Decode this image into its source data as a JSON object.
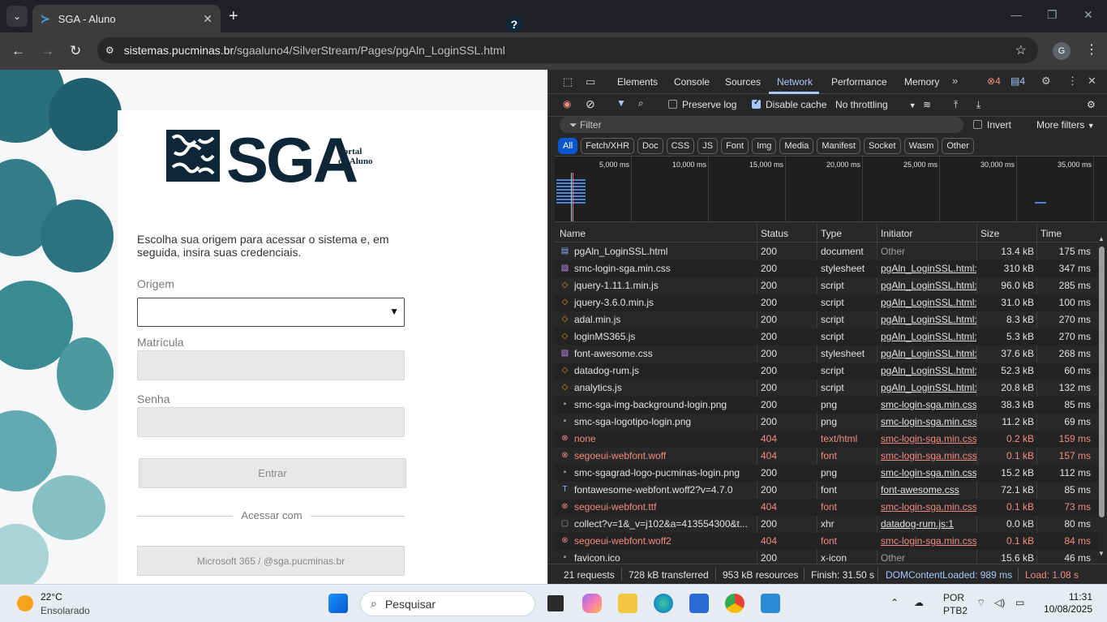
{
  "browser": {
    "tab_title": "SGA - Aluno",
    "url_host": "sistemas.pucminas.br",
    "url_path": "/sgaaluno4/SilverStream/Pages/pgAln_LoginSSL.html",
    "profile_initial": "G"
  },
  "login": {
    "logo_text": "SGA",
    "logo_subtitle_1": "Portal",
    "logo_subtitle_2": "do Aluno",
    "intro": "Escolha sua origem para acessar o sistema e,  em seguida, insira suas credenciais.",
    "origem_label": "Origem",
    "matricula_label": "Matrícula",
    "senha_label": "Senha",
    "entrar_label": "Entrar",
    "acessar_com": "Acessar com",
    "ms365_label": "Microsoft 365 / @sga.pucminas.br",
    "help_glyph": "?"
  },
  "devtools": {
    "tabs": [
      "Elements",
      "Console",
      "Sources",
      "Network",
      "Performance",
      "Memory"
    ],
    "errors_count": "4",
    "messages_count": "4",
    "toolbar": {
      "preserve_log": "Preserve log",
      "disable_cache": "Disable cache",
      "throttling": "No throttling"
    },
    "filter_placeholder": "Filter",
    "invert": "Invert",
    "more_filters": "More filters",
    "chips": [
      "All",
      "Fetch/XHR",
      "Doc",
      "CSS",
      "JS",
      "Font",
      "Img",
      "Media",
      "Manifest",
      "Socket",
      "Wasm",
      "Other"
    ],
    "timeline_labels": [
      "5,000 ms",
      "10,000 ms",
      "15,000 ms",
      "20,000 ms",
      "25,000 ms",
      "30,000 ms",
      "35,000 ms"
    ],
    "columns": [
      "Name",
      "Status",
      "Type",
      "Initiator",
      "Size",
      "Time"
    ],
    "rows": [
      {
        "icon": "doc",
        "name": "pgAln_LoginSSL.html",
        "status": "200",
        "type": "document",
        "initiator": "Other",
        "size": "13.4 kB",
        "time": "175 ms",
        "err": false
      },
      {
        "icon": "css",
        "name": "smc-login-sga.min.css",
        "status": "200",
        "type": "stylesheet",
        "initiator": "pgAln_LoginSSL.html:4",
        "size": "310 kB",
        "time": "347 ms",
        "err": false
      },
      {
        "icon": "js",
        "name": "jquery-1.11.1.min.js",
        "status": "200",
        "type": "script",
        "initiator": "pgAln_LoginSSL.html:4",
        "size": "96.0 kB",
        "time": "285 ms",
        "err": false
      },
      {
        "icon": "js",
        "name": "jquery-3.6.0.min.js",
        "status": "200",
        "type": "script",
        "initiator": "pgAln_LoginSSL.html:4",
        "size": "31.0 kB",
        "time": "100 ms",
        "err": false
      },
      {
        "icon": "js",
        "name": "adal.min.js",
        "status": "200",
        "type": "script",
        "initiator": "pgAln_LoginSSL.html:4",
        "size": "8.3 kB",
        "time": "270 ms",
        "err": false
      },
      {
        "icon": "js",
        "name": "loginMS365.js",
        "status": "200",
        "type": "script",
        "initiator": "pgAln_LoginSSL.html:4",
        "size": "5.3 kB",
        "time": "270 ms",
        "err": false
      },
      {
        "icon": "css",
        "name": "font-awesome.css",
        "status": "200",
        "type": "stylesheet",
        "initiator": "pgAln_LoginSSL.html:4",
        "size": "37.6 kB",
        "time": "268 ms",
        "err": false
      },
      {
        "icon": "js",
        "name": "datadog-rum.js",
        "status": "200",
        "type": "script",
        "initiator": "pgAln_LoginSSL.html:8",
        "size": "52.3 kB",
        "time": "60 ms",
        "err": false
      },
      {
        "icon": "js",
        "name": "analytics.js",
        "status": "200",
        "type": "script",
        "initiator": "pgAln_LoginSSL.html:3",
        "size": "20.8 kB",
        "time": "132 ms",
        "err": false
      },
      {
        "icon": "img",
        "name": "smc-sga-img-background-login.png",
        "status": "200",
        "type": "png",
        "initiator": "smc-login-sga.min.css",
        "size": "38.3 kB",
        "time": "85 ms",
        "err": false
      },
      {
        "icon": "img",
        "name": "smc-sga-logotipo-login.png",
        "status": "200",
        "type": "png",
        "initiator": "smc-login-sga.min.css",
        "size": "11.2 kB",
        "time": "69 ms",
        "err": false
      },
      {
        "icon": "error",
        "name": "none",
        "status": "404",
        "type": "text/html",
        "initiator": "smc-login-sga.min.css",
        "size": "0.2 kB",
        "time": "159 ms",
        "err": true
      },
      {
        "icon": "error",
        "name": "segoeui-webfont.woff",
        "status": "404",
        "type": "font",
        "initiator": "smc-login-sga.min.css",
        "size": "0.1 kB",
        "time": "157 ms",
        "err": true
      },
      {
        "icon": "img",
        "name": "smc-sgagrad-logo-pucminas-login.png",
        "status": "200",
        "type": "png",
        "initiator": "smc-login-sga.min.css",
        "size": "15.2 kB",
        "time": "112 ms",
        "err": false
      },
      {
        "icon": "font",
        "name": "fontawesome-webfont.woff2?v=4.7.0",
        "status": "200",
        "type": "font",
        "initiator": "font-awesome.css",
        "size": "72.1 kB",
        "time": "85 ms",
        "err": false
      },
      {
        "icon": "error",
        "name": "segoeui-webfont.ttf",
        "status": "404",
        "type": "font",
        "initiator": "smc-login-sga.min.css",
        "size": "0.1 kB",
        "time": "73 ms",
        "err": true
      },
      {
        "icon": "file",
        "name": "collect?v=1&_v=j102&a=413554300&t...",
        "status": "200",
        "type": "xhr",
        "initiator": "datadog-rum.js:1",
        "size": "0.0 kB",
        "time": "80 ms",
        "err": false
      },
      {
        "icon": "error",
        "name": "segoeui-webfont.woff2",
        "status": "404",
        "type": "font",
        "initiator": "smc-login-sga.min.css",
        "size": "0.1 kB",
        "time": "84 ms",
        "err": true
      },
      {
        "icon": "img",
        "name": "favicon.ico",
        "status": "200",
        "type": "x-icon",
        "initiator": "Other",
        "size": "15.6 kB",
        "time": "46 ms",
        "err": false
      }
    ],
    "status_bar": {
      "requests": "21 requests",
      "transferred": "728 kB transferred",
      "resources": "953 kB resources",
      "finish": "Finish: 31.50 s",
      "dcl": "DOMContentLoaded: 989 ms",
      "load": "Load: 1.08 s"
    },
    "colors": {
      "accent": "#a8c7fa",
      "error": "#f28b82",
      "dcl": "#a8c7fa",
      "load": "#f28b82"
    }
  },
  "taskbar": {
    "temp": "22°C",
    "weather": "Ensolarado",
    "search_placeholder": "Pesquisar",
    "lang_1": "POR",
    "lang_2": "PTB2",
    "time": "11:31",
    "date": "10/08/2025"
  }
}
